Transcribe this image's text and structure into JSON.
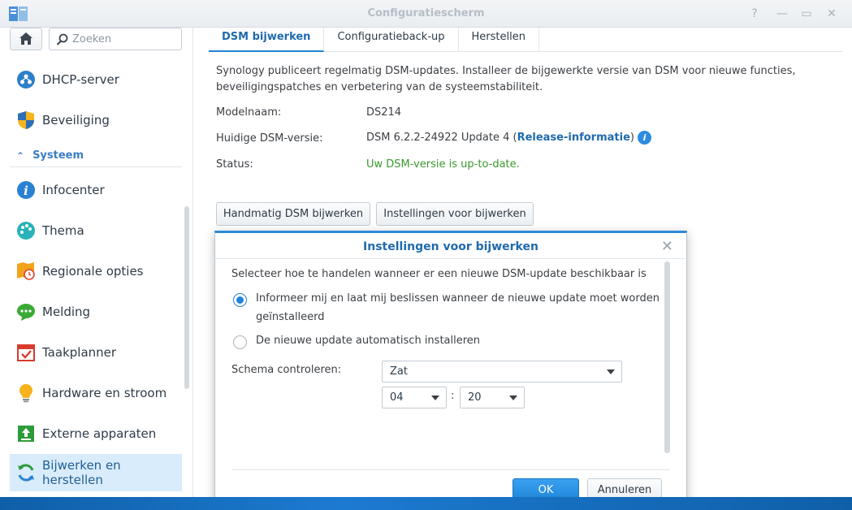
{
  "window": {
    "title": "Configuratiescherm",
    "help_glyph": "?",
    "minimize_glyph": "—",
    "maximize_glyph": "▭",
    "close_glyph": "✕"
  },
  "sidebar": {
    "search_placeholder": "Zoeken",
    "items_top": [
      {
        "label": "DHCP-server",
        "icon": "dhcp-icon"
      },
      {
        "label": "Beveiliging",
        "icon": "shield-icon"
      }
    ],
    "section": {
      "label": "Systeem",
      "chevron": "⌃"
    },
    "items": [
      {
        "label": "Infocenter",
        "icon": "info-icon"
      },
      {
        "label": "Thema",
        "icon": "palette-icon"
      },
      {
        "label": "Regionale opties",
        "icon": "regional-clock-icon"
      },
      {
        "label": "Melding",
        "icon": "chat-bubble-icon"
      },
      {
        "label": "Taakplanner",
        "icon": "calendar-check-icon"
      },
      {
        "label": "Hardware en stroom",
        "icon": "lightbulb-icon"
      },
      {
        "label": "Externe apparaten",
        "icon": "upload-box-icon"
      },
      {
        "label": "Bijwerken en herstellen",
        "icon": "refresh-icon",
        "active": true
      }
    ]
  },
  "main": {
    "tabs": [
      {
        "label": "DSM bijwerken",
        "active": true
      },
      {
        "label": "Configuratieback-up"
      },
      {
        "label": "Herstellen"
      }
    ],
    "description": "Synology publiceert regelmatig DSM-updates. Installeer de bijgewerkte versie van DSM voor nieuwe functies, beveiligingspatches en verbetering van de systeemstabiliteit.",
    "model_label": "Modelnaam:",
    "model_value": "DS214",
    "version_label": "Huidige DSM-versie:",
    "version_value": "DSM 6.2.2-24922 Update 4 (",
    "version_link": "Release-informatie",
    "version_close": ")",
    "status_label": "Status:",
    "status_value": "Uw DSM-versie is up-to-date.",
    "manual_update_button": "Handmatig DSM bijwerken",
    "update_settings_button": "Instellingen voor bijwerken"
  },
  "dialog": {
    "title": "Instellingen voor bijwerken",
    "intro": "Selecteer hoe te handelen wanneer er een nieuwe DSM-update beschikbaar is",
    "option1_line1": "Informeer mij en laat mij beslissen wanneer de nieuwe update moet worden",
    "option1_line2": "geïnstalleerd",
    "option2": "De nieuwe update automatisch installeren",
    "selected_option": 1,
    "schedule_label": "Schema controleren:",
    "day_value": "Zat",
    "hour_value": "04",
    "colon": ":",
    "minute_value": "20",
    "ok_button": "OK",
    "cancel_button": "Annuleren"
  },
  "colors": {
    "accent": "#1f84d8",
    "status_ok": "#3a9a2d",
    "active_nav_bg": "#d9ecfb"
  }
}
